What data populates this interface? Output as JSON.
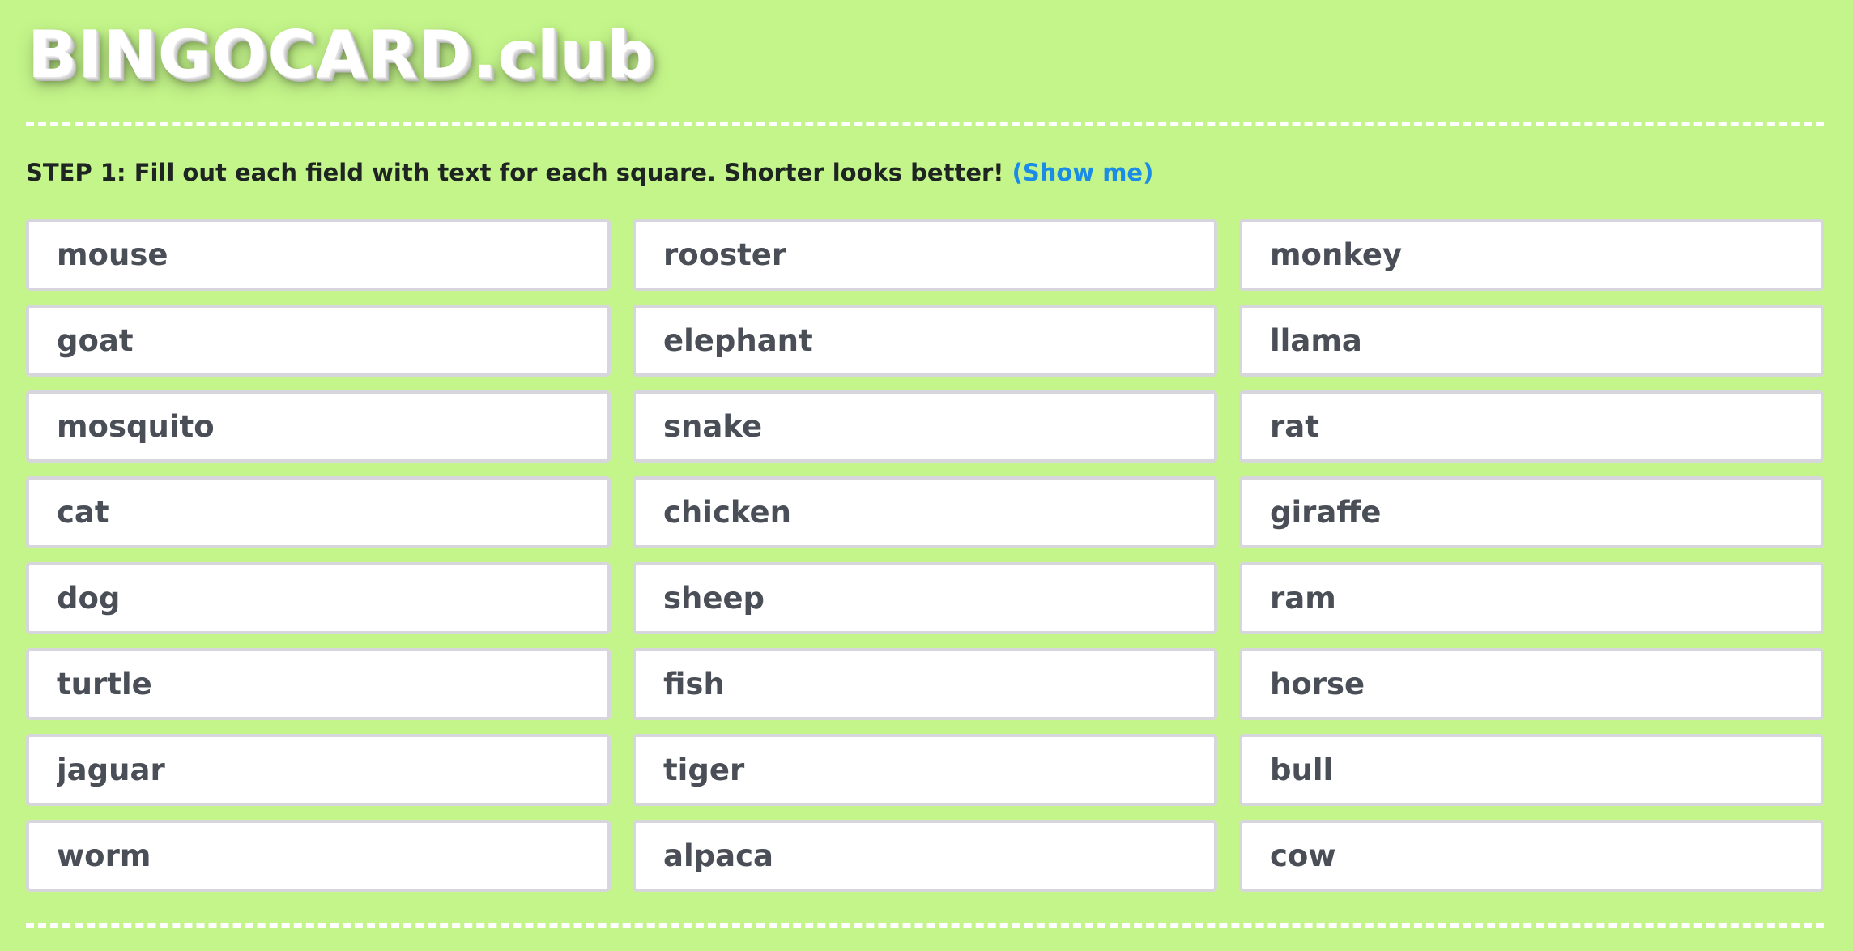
{
  "header": {
    "logo_text": "BINGOCARD.club"
  },
  "step1": {
    "label": "STEP 1:",
    "instruction": " Fill out each field with text for each square. Shorter looks better! ",
    "show_me_link": "(Show me)"
  },
  "squares": [
    "mouse",
    "rooster",
    "monkey",
    "goat",
    "elephant",
    "llama",
    "mosquito",
    "snake",
    "rat",
    "cat",
    "chicken",
    "giraffe",
    "dog",
    "sheep",
    "ram",
    "turtle",
    "fish",
    "horse",
    "jaguar",
    "tiger",
    "bull",
    "worm",
    "alpaca",
    "cow"
  ],
  "colors": {
    "background": "#c4f58a",
    "link": "#1a8be6",
    "input_text": "#4a4f57",
    "input_border": "#d6d6dc"
  }
}
